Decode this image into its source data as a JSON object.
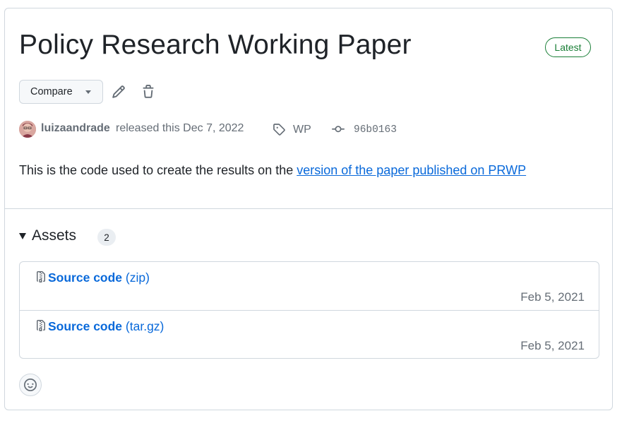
{
  "release": {
    "title": "Policy Research Working Paper",
    "latest_badge": "Latest",
    "compare_label": "Compare",
    "author": "luizaandrade",
    "released_text": "released this Dec 7, 2022",
    "tag": "WP",
    "commit": "96b0163",
    "body_prefix": "This is the code used to create the results on the ",
    "body_link": "version of the paper published on PRWP"
  },
  "assets": {
    "heading": "Assets",
    "count": "2",
    "items": [
      {
        "name": "Source code",
        "ext": "(zip)",
        "date": "Feb 5, 2021"
      },
      {
        "name": "Source code",
        "ext": "(tar.gz)",
        "date": "Feb 5, 2021"
      }
    ]
  },
  "colors": {
    "accent_link": "#0969da",
    "latest_green": "#1a7f37",
    "muted": "#656d76",
    "border": "#d0d7de"
  },
  "icons": [
    "caret-down-icon",
    "pencil-icon",
    "trash-icon",
    "tag-icon",
    "commit-icon",
    "file-zip-icon",
    "smiley-icon",
    "triangle-down-icon"
  ]
}
